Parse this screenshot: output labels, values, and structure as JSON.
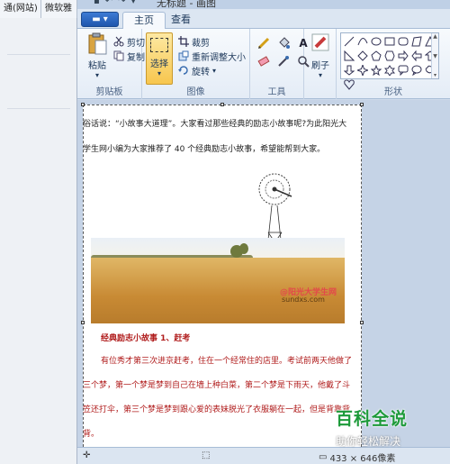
{
  "background_browser": {
    "tabs": [
      "通(网站)",
      "微软雅"
    ]
  },
  "window": {
    "title": "无标题 - 画图"
  },
  "ribbon_tabs": {
    "file_menu": "▾",
    "home": "主页",
    "view": "查看"
  },
  "clipboard": {
    "paste": "粘贴",
    "cut": "剪切",
    "copy": "复制",
    "label": "剪贴板"
  },
  "image_group": {
    "select": "选择",
    "crop": "裁剪",
    "resize": "重新调整大小",
    "rotate": "旋转",
    "label": "图像"
  },
  "tools_group": {
    "label": "工具"
  },
  "brushes": {
    "label": "刷子"
  },
  "shapes_group": {
    "label": "形状"
  },
  "canvas_text": {
    "line1": "俗话说：“小故事大道理”。大家看过那些经典的励志小故事呢?为此阳光大",
    "line2": "学生网小编为大家推荐了 40 个经典励志小故事，希望能帮到大家。",
    "watermark_cn": "@阳光大学生网",
    "watermark_url": "sundxs.com",
    "red_title": "经典励志小故事 1、赶考",
    "red_line1": "有位秀才第三次进京赶考，住在一个经常住的店里。考试前两天他做了",
    "red_line2": "三个梦，第一个梦是梦到自己在墙上种白菜，第二个梦是下雨天，他戴了斗",
    "red_line3": "笠还打伞，第三个梦是梦到跟心爱的表妹脱光了衣服躺在一起，但是背靠背",
    "red_line4": "背。"
  },
  "statusbar": {
    "size": "433 × 646像素"
  },
  "watermark": {
    "big": "百科全说",
    "small": "助你轻松解决"
  },
  "colors": {
    "accent": "#f7c64e",
    "red_text": "#b01c1c",
    "watermark_green": "#1d9a3a"
  }
}
